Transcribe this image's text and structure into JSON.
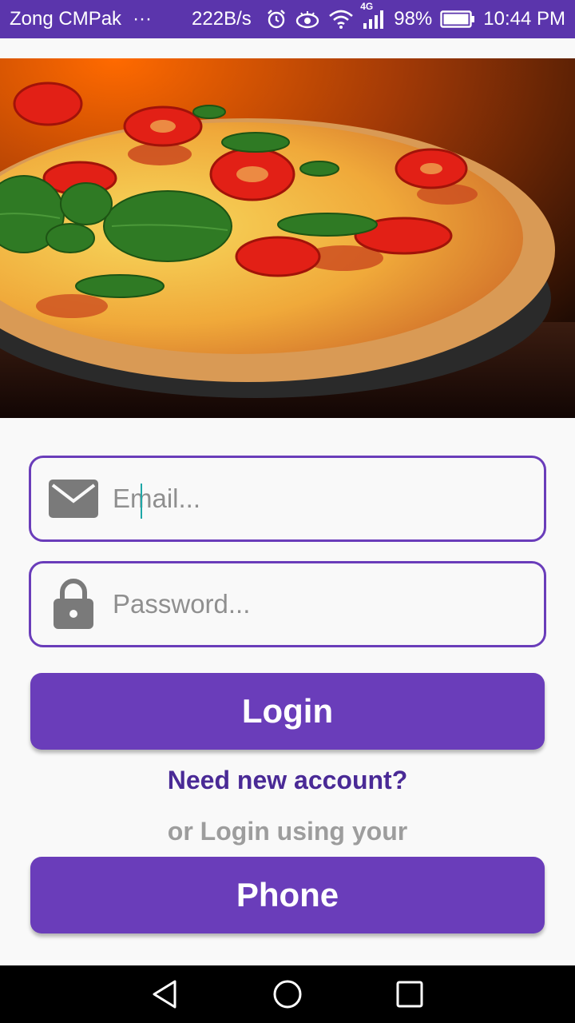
{
  "status_bar": {
    "carrier": "Zong CMPak",
    "more": "···",
    "net_speed": "222B/s",
    "network_type": "4G",
    "battery": "98%",
    "time": "10:44 PM",
    "icons": [
      "alarm-icon",
      "eye-icon",
      "wifi-icon",
      "signal-icon",
      "battery-icon"
    ]
  },
  "hero": {
    "image": "pizza-photo"
  },
  "login_form": {
    "email": {
      "placeholder": "Email...",
      "value": "",
      "icon": "mail-icon"
    },
    "password": {
      "placeholder": "Password...",
      "value": "",
      "icon": "lock-icon"
    },
    "login_label": "Login",
    "new_account_link": "Need new account?",
    "alt_login_text": "or Login using your",
    "phone_label": "Phone"
  },
  "nav_bar": {
    "buttons": [
      "back-icon",
      "home-icon",
      "recents-icon"
    ]
  },
  "colors": {
    "primary": "#6a3dba",
    "status_bar": "#5b35ac",
    "link": "#4a2a96",
    "muted": "#9d9d9d"
  }
}
